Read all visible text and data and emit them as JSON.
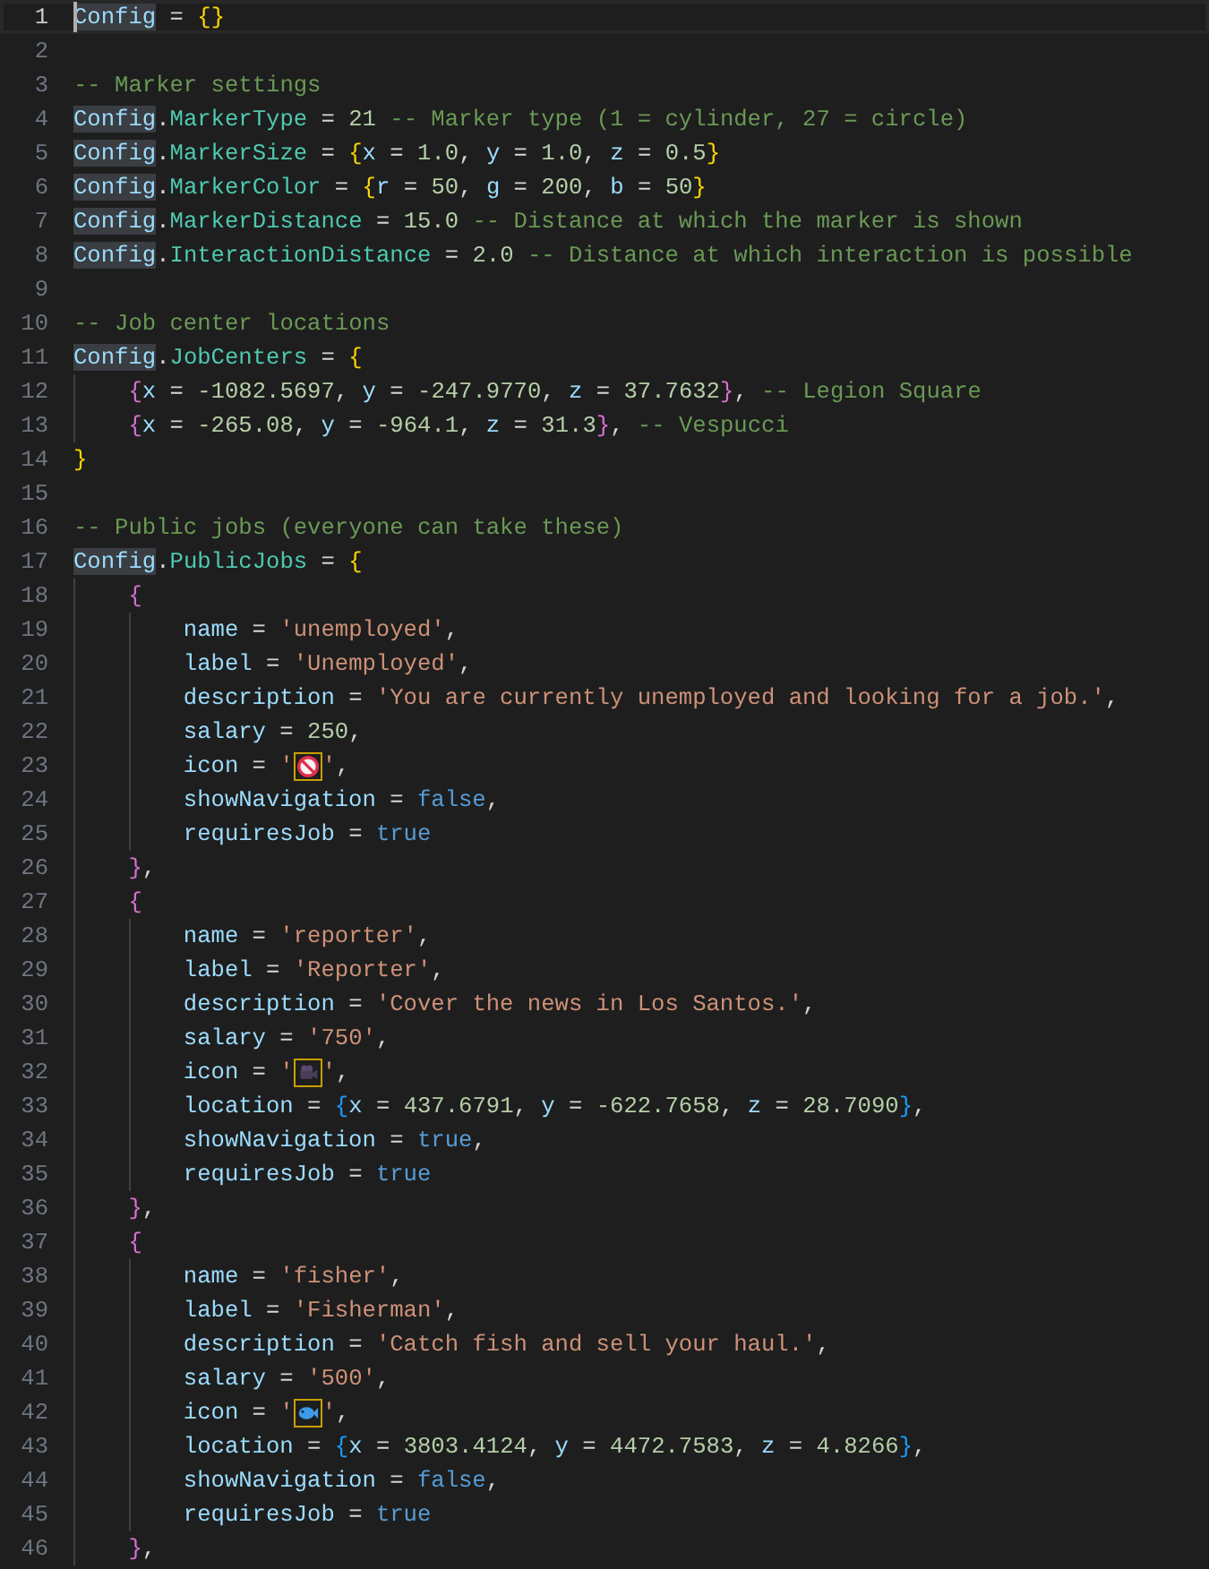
{
  "editor": {
    "lines": [
      {
        "number": "1",
        "selected": true,
        "tokens": [
          {
            "kind": "var",
            "text": "Config",
            "highlighted": true
          },
          {
            "kind": "op",
            "text": " = "
          },
          {
            "kind": "bracket",
            "text": "{",
            "color": "#ffd700"
          },
          {
            "kind": "bracket",
            "text": "}",
            "color": "#ffd700"
          }
        ]
      },
      {
        "number": "2",
        "selected": false
      },
      {
        "number": "3",
        "selected": false,
        "tokens": [
          {
            "kind": "comment",
            "text": "-- Marker settings"
          }
        ]
      },
      {
        "number": "4",
        "selected": false,
        "tokens": [
          {
            "kind": "var",
            "text": "Config",
            "highlighted": true
          },
          {
            "kind": "op",
            "text": "."
          },
          {
            "kind": "field",
            "text": "MarkerType"
          },
          {
            "kind": "op",
            "text": " = "
          },
          {
            "kind": "num",
            "text": "21"
          },
          {
            "kind": "comment",
            "text": " -- Marker type (1 = cylinder, 27 = circle)"
          }
        ]
      },
      {
        "number": "5",
        "selected": false,
        "tokens": [
          {
            "kind": "var",
            "text": "Config",
            "highlighted": true
          },
          {
            "kind": "op",
            "text": "."
          },
          {
            "kind": "field",
            "text": "MarkerSize"
          },
          {
            "kind": "op",
            "text": " = "
          },
          {
            "kind": "bracket",
            "text": "{",
            "color": "#ffd700"
          },
          {
            "kind": "key",
            "text": "x"
          },
          {
            "kind": "op",
            "text": " = "
          },
          {
            "kind": "num",
            "text": "1.0"
          },
          {
            "kind": "op",
            "text": ", "
          },
          {
            "kind": "key",
            "text": "y"
          },
          {
            "kind": "op",
            "text": " = "
          },
          {
            "kind": "num",
            "text": "1.0"
          },
          {
            "kind": "op",
            "text": ", "
          },
          {
            "kind": "key",
            "text": "z"
          },
          {
            "kind": "op",
            "text": " = "
          },
          {
            "kind": "num",
            "text": "0.5"
          },
          {
            "kind": "bracket",
            "text": "}",
            "color": "#ffd700"
          }
        ]
      },
      {
        "number": "6",
        "selected": false,
        "tokens": [
          {
            "kind": "var",
            "text": "Config",
            "highlighted": true
          },
          {
            "kind": "op",
            "text": "."
          },
          {
            "kind": "field",
            "text": "MarkerColor"
          },
          {
            "kind": "op",
            "text": " = "
          },
          {
            "kind": "bracket",
            "text": "{",
            "color": "#ffd700"
          },
          {
            "kind": "key",
            "text": "r"
          },
          {
            "kind": "op",
            "text": " = "
          },
          {
            "kind": "num",
            "text": "50"
          },
          {
            "kind": "op",
            "text": ", "
          },
          {
            "kind": "key",
            "text": "g"
          },
          {
            "kind": "op",
            "text": " = "
          },
          {
            "kind": "num",
            "text": "200"
          },
          {
            "kind": "op",
            "text": ", "
          },
          {
            "kind": "key",
            "text": "b"
          },
          {
            "kind": "op",
            "text": " = "
          },
          {
            "kind": "num",
            "text": "50"
          },
          {
            "kind": "bracket",
            "text": "}",
            "color": "#ffd700"
          }
        ]
      },
      {
        "number": "7",
        "selected": false,
        "tokens": [
          {
            "kind": "var",
            "text": "Config",
            "highlighted": true
          },
          {
            "kind": "op",
            "text": "."
          },
          {
            "kind": "field",
            "text": "MarkerDistance"
          },
          {
            "kind": "op",
            "text": " = "
          },
          {
            "kind": "num",
            "text": "15.0"
          },
          {
            "kind": "comment",
            "text": " -- Distance at which the marker is shown"
          }
        ]
      },
      {
        "number": "8",
        "selected": false,
        "tokens": [
          {
            "kind": "var",
            "text": "Config",
            "highlighted": true
          },
          {
            "kind": "op",
            "text": "."
          },
          {
            "kind": "field",
            "text": "InteractionDistance"
          },
          {
            "kind": "op",
            "text": " = "
          },
          {
            "kind": "num",
            "text": "2.0"
          },
          {
            "kind": "comment",
            "text": " -- Distance at which interaction is possible"
          }
        ]
      },
      {
        "number": "9",
        "selected": false
      },
      {
        "number": "10",
        "selected": false,
        "tokens": [
          {
            "kind": "comment",
            "text": "-- Job center locations"
          }
        ]
      },
      {
        "number": "11",
        "selected": false,
        "tokens": [
          {
            "kind": "var",
            "text": "Config",
            "highlighted": true
          },
          {
            "kind": "op",
            "text": "."
          },
          {
            "kind": "field",
            "text": "JobCenters"
          },
          {
            "kind": "op",
            "text": " = "
          },
          {
            "kind": "bracket",
            "text": "{",
            "color": "#ffd700"
          }
        ]
      },
      {
        "number": "12",
        "selected": false,
        "tokens": [
          {
            "kind": "guide"
          },
          {
            "kind": "bracket",
            "text": "{",
            "color": "#da70d6"
          },
          {
            "kind": "key",
            "text": "x"
          },
          {
            "kind": "op",
            "text": " = "
          },
          {
            "kind": "num",
            "text": "-1082.5697"
          },
          {
            "kind": "op",
            "text": ", "
          },
          {
            "kind": "key",
            "text": "y"
          },
          {
            "kind": "op",
            "text": " = "
          },
          {
            "kind": "num",
            "text": "-247.9770"
          },
          {
            "kind": "op",
            "text": ", "
          },
          {
            "kind": "key",
            "text": "z"
          },
          {
            "kind": "op",
            "text": " = "
          },
          {
            "kind": "num",
            "text": "37.7632"
          },
          {
            "kind": "bracket",
            "text": "}",
            "color": "#da70d6"
          },
          {
            "kind": "op",
            "text": ","
          },
          {
            "kind": "comment",
            "text": " -- Legion Square"
          }
        ]
      },
      {
        "number": "13",
        "selected": false,
        "tokens": [
          {
            "kind": "guide"
          },
          {
            "kind": "bracket",
            "text": "{",
            "color": "#da70d6"
          },
          {
            "kind": "key",
            "text": "x"
          },
          {
            "kind": "op",
            "text": " = "
          },
          {
            "kind": "num",
            "text": "-265.08"
          },
          {
            "kind": "op",
            "text": ", "
          },
          {
            "kind": "key",
            "text": "y"
          },
          {
            "kind": "op",
            "text": " = "
          },
          {
            "kind": "num",
            "text": "-964.1"
          },
          {
            "kind": "op",
            "text": ", "
          },
          {
            "kind": "key",
            "text": "z"
          },
          {
            "kind": "op",
            "text": " = "
          },
          {
            "kind": "num",
            "text": "31.3"
          },
          {
            "kind": "bracket",
            "text": "}",
            "color": "#da70d6"
          },
          {
            "kind": "op",
            "text": ","
          },
          {
            "kind": "comment",
            "text": " -- Vespucci"
          }
        ]
      },
      {
        "number": "14",
        "selected": false,
        "tokens": [
          {
            "kind": "bracket",
            "text": "}",
            "color": "#ffd700"
          }
        ]
      },
      {
        "number": "15",
        "selected": false
      },
      {
        "number": "16",
        "selected": false,
        "tokens": [
          {
            "kind": "comment",
            "text": "-- Public jobs (everyone can take these)"
          }
        ]
      },
      {
        "number": "17",
        "selected": false,
        "tokens": [
          {
            "kind": "var",
            "text": "Config",
            "highlighted": true
          },
          {
            "kind": "op",
            "text": "."
          },
          {
            "kind": "field",
            "text": "PublicJobs"
          },
          {
            "kind": "op",
            "text": " = "
          },
          {
            "kind": "bracket",
            "text": "{",
            "color": "#ffd700"
          }
        ]
      },
      {
        "number": "18",
        "selected": false,
        "tokens": [
          {
            "kind": "guide"
          },
          {
            "kind": "bracket",
            "text": "{",
            "color": "#da70d6"
          }
        ]
      },
      {
        "number": "19",
        "selected": false,
        "tokens": [
          {
            "kind": "guide"
          },
          {
            "kind": "guide"
          },
          {
            "kind": "key",
            "text": "name"
          },
          {
            "kind": "op",
            "text": " = "
          },
          {
            "kind": "str",
            "text": "'unemployed'"
          },
          {
            "kind": "op",
            "text": ","
          }
        ]
      },
      {
        "number": "20",
        "selected": false,
        "tokens": [
          {
            "kind": "guide"
          },
          {
            "kind": "guide"
          },
          {
            "kind": "key",
            "text": "label"
          },
          {
            "kind": "op",
            "text": " = "
          },
          {
            "kind": "str",
            "text": "'Unemployed'"
          },
          {
            "kind": "op",
            "text": ","
          }
        ]
      },
      {
        "number": "21",
        "selected": false,
        "tokens": [
          {
            "kind": "guide"
          },
          {
            "kind": "guide"
          },
          {
            "kind": "key",
            "text": "description"
          },
          {
            "kind": "op",
            "text": " = "
          },
          {
            "kind": "str",
            "text": "'You are currently unemployed and looking for a job.'"
          },
          {
            "kind": "op",
            "text": ","
          }
        ]
      },
      {
        "number": "22",
        "selected": false,
        "tokens": [
          {
            "kind": "guide"
          },
          {
            "kind": "guide"
          },
          {
            "kind": "key",
            "text": "salary"
          },
          {
            "kind": "op",
            "text": " = "
          },
          {
            "kind": "num",
            "text": "250"
          },
          {
            "kind": "op",
            "text": ","
          }
        ]
      },
      {
        "number": "23",
        "selected": false,
        "tokens": [
          {
            "kind": "guide"
          },
          {
            "kind": "guide"
          },
          {
            "kind": "key",
            "text": "icon"
          },
          {
            "kind": "op",
            "text": " = "
          },
          {
            "kind": "str",
            "text": "'"
          },
          {
            "kind": "icon"
          },
          {
            "kind": "str",
            "text": "'"
          },
          {
            "kind": "op",
            "text": ","
          }
        ]
      },
      {
        "number": "24",
        "selected": false,
        "tokens": [
          {
            "kind": "guide"
          },
          {
            "kind": "guide"
          },
          {
            "kind": "key",
            "text": "showNavigation"
          },
          {
            "kind": "op",
            "text": " = "
          },
          {
            "kind": "bool",
            "text": "false"
          },
          {
            "kind": "op",
            "text": ","
          }
        ]
      },
      {
        "number": "25",
        "selected": false,
        "tokens": [
          {
            "kind": "guide"
          },
          {
            "kind": "guide"
          },
          {
            "kind": "key",
            "text": "requiresJob"
          },
          {
            "kind": "op",
            "text": " = "
          },
          {
            "kind": "bool",
            "text": "true"
          }
        ]
      },
      {
        "number": "26",
        "selected": false,
        "tokens": [
          {
            "kind": "guide"
          },
          {
            "kind": "bracket",
            "text": "}",
            "color": "#da70d6"
          },
          {
            "kind": "op",
            "text": ","
          }
        ]
      },
      {
        "number": "27",
        "selected": false,
        "tokens": [
          {
            "kind": "guide"
          },
          {
            "kind": "bracket",
            "text": "{",
            "color": "#da70d6"
          }
        ]
      },
      {
        "number": "28",
        "selected": false,
        "tokens": [
          {
            "kind": "guide"
          },
          {
            "kind": "guide"
          },
          {
            "kind": "key",
            "text": "name"
          },
          {
            "kind": "op",
            "text": " = "
          },
          {
            "kind": "str",
            "text": "'reporter'"
          },
          {
            "kind": "op",
            "text": ","
          }
        ]
      },
      {
        "number": "29",
        "selected": false,
        "tokens": [
          {
            "kind": "guide"
          },
          {
            "kind": "guide"
          },
          {
            "kind": "key",
            "text": "label"
          },
          {
            "kind": "op",
            "text": " = "
          },
          {
            "kind": "str",
            "text": "'Reporter'"
          },
          {
            "kind": "op",
            "text": ","
          }
        ]
      },
      {
        "number": "30",
        "selected": false,
        "tokens": [
          {
            "kind": "guide"
          },
          {
            "kind": "guide"
          },
          {
            "kind": "key",
            "text": "description"
          },
          {
            "kind": "op",
            "text": " = "
          },
          {
            "kind": "str",
            "text": "'Cover the news in Los Santos.'"
          },
          {
            "kind": "op",
            "text": ","
          }
        ]
      },
      {
        "number": "31",
        "selected": false,
        "tokens": [
          {
            "kind": "guide"
          },
          {
            "kind": "guide"
          },
          {
            "kind": "key",
            "text": "salary"
          },
          {
            "kind": "op",
            "text": " = "
          },
          {
            "kind": "str",
            "text": "'750'"
          },
          {
            "kind": "op",
            "text": ","
          }
        ]
      },
      {
        "number": "32",
        "selected": false,
        "tokens": [
          {
            "kind": "guide"
          },
          {
            "kind": "guide"
          },
          {
            "kind": "key",
            "text": "icon"
          },
          {
            "kind": "op",
            "text": " = "
          },
          {
            "kind": "str",
            "text": "'"
          },
          {
            "kind": "icon"
          },
          {
            "kind": "str",
            "text": "'"
          },
          {
            "kind": "op",
            "text": ","
          }
        ]
      },
      {
        "number": "33",
        "selected": false,
        "tokens": [
          {
            "kind": "guide"
          },
          {
            "kind": "guide"
          },
          {
            "kind": "key",
            "text": "location"
          },
          {
            "kind": "op",
            "text": " = "
          },
          {
            "kind": "bracket",
            "text": "{",
            "color": "#179fff"
          },
          {
            "kind": "key",
            "text": "x"
          },
          {
            "kind": "op",
            "text": " = "
          },
          {
            "kind": "num",
            "text": "437.6791"
          },
          {
            "kind": "op",
            "text": ", "
          },
          {
            "kind": "key",
            "text": "y"
          },
          {
            "kind": "op",
            "text": " = "
          },
          {
            "kind": "num",
            "text": "-622.7658"
          },
          {
            "kind": "op",
            "text": ", "
          },
          {
            "kind": "key",
            "text": "z"
          },
          {
            "kind": "op",
            "text": " = "
          },
          {
            "kind": "num",
            "text": "28.7090"
          },
          {
            "kind": "bracket",
            "text": "}",
            "color": "#179fff"
          },
          {
            "kind": "op",
            "text": ","
          }
        ]
      },
      {
        "number": "34",
        "selected": false,
        "tokens": [
          {
            "kind": "guide"
          },
          {
            "kind": "guide"
          },
          {
            "kind": "key",
            "text": "showNavigation"
          },
          {
            "kind": "op",
            "text": " = "
          },
          {
            "kind": "bool",
            "text": "true"
          },
          {
            "kind": "op",
            "text": ","
          }
        ]
      },
      {
        "number": "35",
        "selected": false,
        "tokens": [
          {
            "kind": "guide"
          },
          {
            "kind": "guide"
          },
          {
            "kind": "key",
            "text": "requiresJob"
          },
          {
            "kind": "op",
            "text": " = "
          },
          {
            "kind": "bool",
            "text": "true"
          }
        ]
      },
      {
        "number": "36",
        "selected": false,
        "tokens": [
          {
            "kind": "guide"
          },
          {
            "kind": "bracket",
            "text": "}",
            "color": "#da70d6"
          },
          {
            "kind": "op",
            "text": ","
          }
        ]
      },
      {
        "number": "37",
        "selected": false,
        "tokens": [
          {
            "kind": "guide"
          },
          {
            "kind": "bracket",
            "text": "{",
            "color": "#da70d6"
          }
        ]
      },
      {
        "number": "38",
        "selected": false,
        "tokens": [
          {
            "kind": "guide"
          },
          {
            "kind": "guide"
          },
          {
            "kind": "key",
            "text": "name"
          },
          {
            "kind": "op",
            "text": " = "
          },
          {
            "kind": "str",
            "text": "'fisher'"
          },
          {
            "kind": "op",
            "text": ","
          }
        ]
      },
      {
        "number": "39",
        "selected": false,
        "tokens": [
          {
            "kind": "guide"
          },
          {
            "kind": "guide"
          },
          {
            "kind": "key",
            "text": "label"
          },
          {
            "kind": "op",
            "text": " = "
          },
          {
            "kind": "str",
            "text": "'Fisherman'"
          },
          {
            "kind": "op",
            "text": ","
          }
        ]
      },
      {
        "number": "40",
        "selected": false,
        "tokens": [
          {
            "kind": "guide"
          },
          {
            "kind": "guide"
          },
          {
            "kind": "key",
            "text": "description"
          },
          {
            "kind": "op",
            "text": " = "
          },
          {
            "kind": "str",
            "text": "'Catch fish and sell your haul.'"
          },
          {
            "kind": "op",
            "text": ","
          }
        ]
      },
      {
        "number": "41",
        "selected": false,
        "tokens": [
          {
            "kind": "guide"
          },
          {
            "kind": "guide"
          },
          {
            "kind": "key",
            "text": "salary"
          },
          {
            "kind": "op",
            "text": " = "
          },
          {
            "kind": "str",
            "text": "'500'"
          },
          {
            "kind": "op",
            "text": ","
          }
        ]
      },
      {
        "number": "42",
        "selected": false,
        "tokens": [
          {
            "kind": "guide"
          },
          {
            "kind": "guide"
          },
          {
            "kind": "key",
            "text": "icon"
          },
          {
            "kind": "op",
            "text": " = "
          },
          {
            "kind": "str",
            "text": "'"
          },
          {
            "kind": "icon"
          },
          {
            "kind": "str",
            "text": "'"
          },
          {
            "kind": "op",
            "text": ","
          }
        ]
      },
      {
        "number": "43",
        "selected": false,
        "tokens": [
          {
            "kind": "guide"
          },
          {
            "kind": "guide"
          },
          {
            "kind": "key",
            "text": "location"
          },
          {
            "kind": "op",
            "text": " = "
          },
          {
            "kind": "bracket",
            "text": "{",
            "color": "#179fff"
          },
          {
            "kind": "key",
            "text": "x"
          },
          {
            "kind": "op",
            "text": " = "
          },
          {
            "kind": "num",
            "text": "3803.4124"
          },
          {
            "kind": "op",
            "text": ", "
          },
          {
            "kind": "key",
            "text": "y"
          },
          {
            "kind": "op",
            "text": " = "
          },
          {
            "kind": "num",
            "text": "4472.7583"
          },
          {
            "kind": "op",
            "text": ", "
          },
          {
            "kind": "key",
            "text": "z"
          },
          {
            "kind": "op",
            "text": " = "
          },
          {
            "kind": "num",
            "text": "4.8266"
          },
          {
            "kind": "bracket",
            "text": "}",
            "color": "#179fff"
          },
          {
            "kind": "op",
            "text": ","
          }
        ]
      },
      {
        "number": "44",
        "selected": false,
        "tokens": [
          {
            "kind": "guide"
          },
          {
            "kind": "guide"
          },
          {
            "kind": "key",
            "text": "showNavigation"
          },
          {
            "kind": "op",
            "text": " = "
          },
          {
            "kind": "bool",
            "text": "false"
          },
          {
            "kind": "op",
            "text": ","
          }
        ]
      },
      {
        "number": "45",
        "selected": false,
        "tokens": [
          {
            "kind": "guide"
          },
          {
            "kind": "guide"
          },
          {
            "kind": "key",
            "text": "requiresJob"
          },
          {
            "kind": "op",
            "text": " = "
          },
          {
            "kind": "bool",
            "text": "true"
          }
        ]
      },
      {
        "number": "46",
        "selected": false,
        "tokens": [
          {
            "kind": "guide"
          },
          {
            "kind": "bracket",
            "text": "}",
            "color": "#da70d6"
          },
          {
            "kind": "op",
            "text": ","
          }
        ]
      }
    ]
  }
}
